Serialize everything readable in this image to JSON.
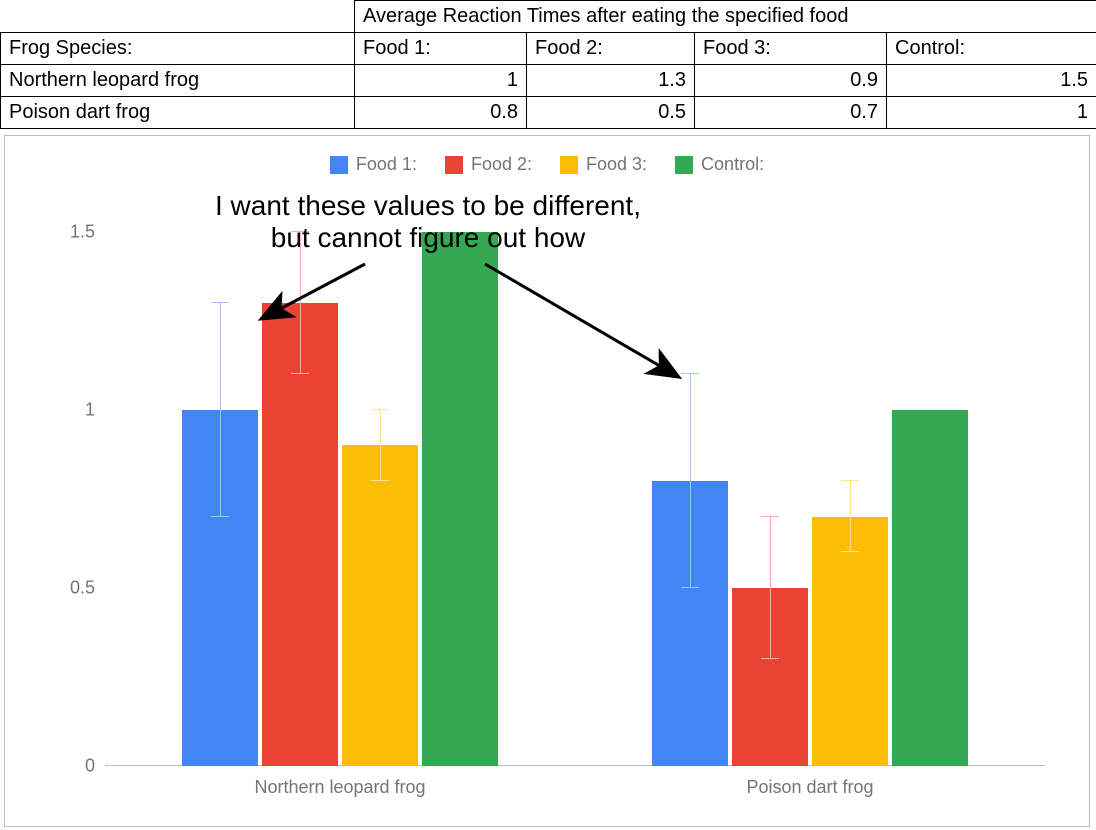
{
  "table": {
    "title": "Average Reaction Times after eating the specified food",
    "row_header_label": "Frog Species:",
    "col_headers": [
      "Food 1:",
      "Food 2:",
      "Food 3:",
      "Control:"
    ],
    "rows": [
      {
        "label": "Northern leopard frog",
        "values": [
          "1",
          "1.3",
          "0.9",
          "1.5"
        ]
      },
      {
        "label": "Poison dart frog",
        "values": [
          "0.8",
          "0.5",
          "0.7",
          "1"
        ]
      }
    ]
  },
  "legend": [
    "Food 1:",
    "Food 2:",
    "Food 3:",
    "Control:"
  ],
  "yticks": [
    "0",
    "0.5",
    "1",
    "1.5"
  ],
  "categories": [
    "Northern leopard frog",
    "Poison dart frog"
  ],
  "annotation": {
    "line1": "I want these values to be different,",
    "line2": "but cannot figure out how"
  },
  "colors": {
    "food1": "#4285f4",
    "food2": "#ea4335",
    "food3": "#fbbc04",
    "control": "#34a853"
  },
  "chart_data": {
    "type": "bar",
    "title": "",
    "xlabel": "",
    "ylabel": "",
    "ylim": [
      0,
      1.6
    ],
    "yticks": [
      0,
      0.5,
      1,
      1.5
    ],
    "categories": [
      "Northern leopard frog",
      "Poison dart frog"
    ],
    "series": [
      {
        "name": "Food 1:",
        "color": "#4285f4",
        "values": [
          1.0,
          0.8
        ],
        "error": [
          0.3,
          0.3
        ]
      },
      {
        "name": "Food 2:",
        "color": "#ea4335",
        "values": [
          1.3,
          0.5
        ],
        "error": [
          0.2,
          0.2
        ]
      },
      {
        "name": "Food 3:",
        "color": "#fbbc04",
        "values": [
          0.9,
          0.7
        ],
        "error": [
          0.1,
          0.1
        ]
      },
      {
        "name": "Control:",
        "color": "#34a853",
        "values": [
          1.5,
          1.0
        ],
        "error": [
          0.0,
          0.0
        ]
      }
    ],
    "legend_position": "top",
    "grid": false,
    "annotation": "I want these values to be different, but cannot figure out how",
    "annotation_arrows_to": [
      {
        "category": "Northern leopard frog",
        "series": "Food 1:"
      },
      {
        "category": "Poison dart frog",
        "series": "Food 1:"
      }
    ]
  }
}
